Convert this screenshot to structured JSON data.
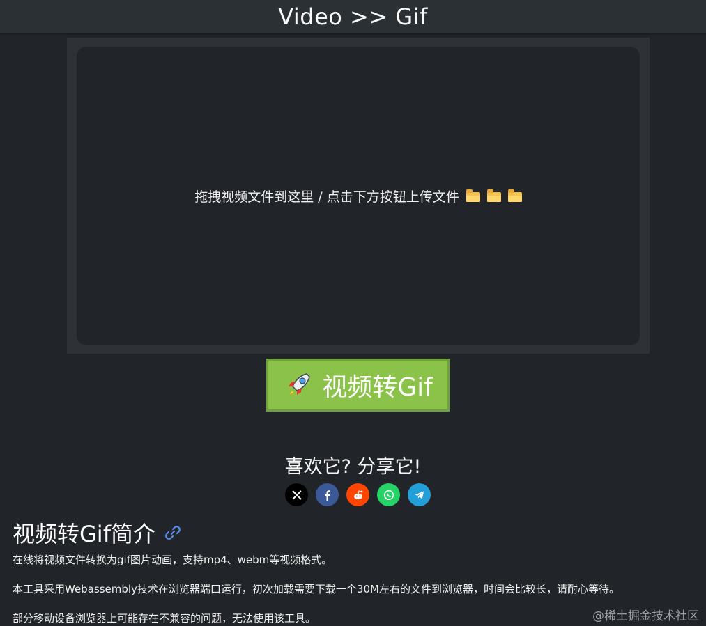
{
  "header": {
    "title": "Video >> Gif"
  },
  "dropzone": {
    "text": "拖拽视频文件到这里 / 点击下方按钮上传文件",
    "icon": "folder-icon"
  },
  "convert": {
    "label": "视频转Gif",
    "icon": "rocket-icon",
    "color": "#8bc34a"
  },
  "share": {
    "title": "喜欢它? 分享它!",
    "items": [
      {
        "name": "x",
        "color": "#000000"
      },
      {
        "name": "facebook",
        "color": "#3b5998"
      },
      {
        "name": "reddit",
        "color": "#ff4500"
      },
      {
        "name": "whatsapp",
        "color": "#25d366"
      },
      {
        "name": "telegram",
        "color": "#229ed9"
      }
    ]
  },
  "intro": {
    "title": "视频转Gif简介",
    "paragraphs": [
      "在线将视频文件转换为gif图片动画，支持mp4、webm等视频格式。",
      "本工具采用Webassembly技术在浏览器端口运行，初次加载需要下载一个30M左右的文件到浏览器，时间会比较长，请耐心等待。",
      "部分移动设备浏览器上可能存在不兼容的问题，无法使用该工具。"
    ]
  },
  "watermark": "@稀土掘金技术社区"
}
